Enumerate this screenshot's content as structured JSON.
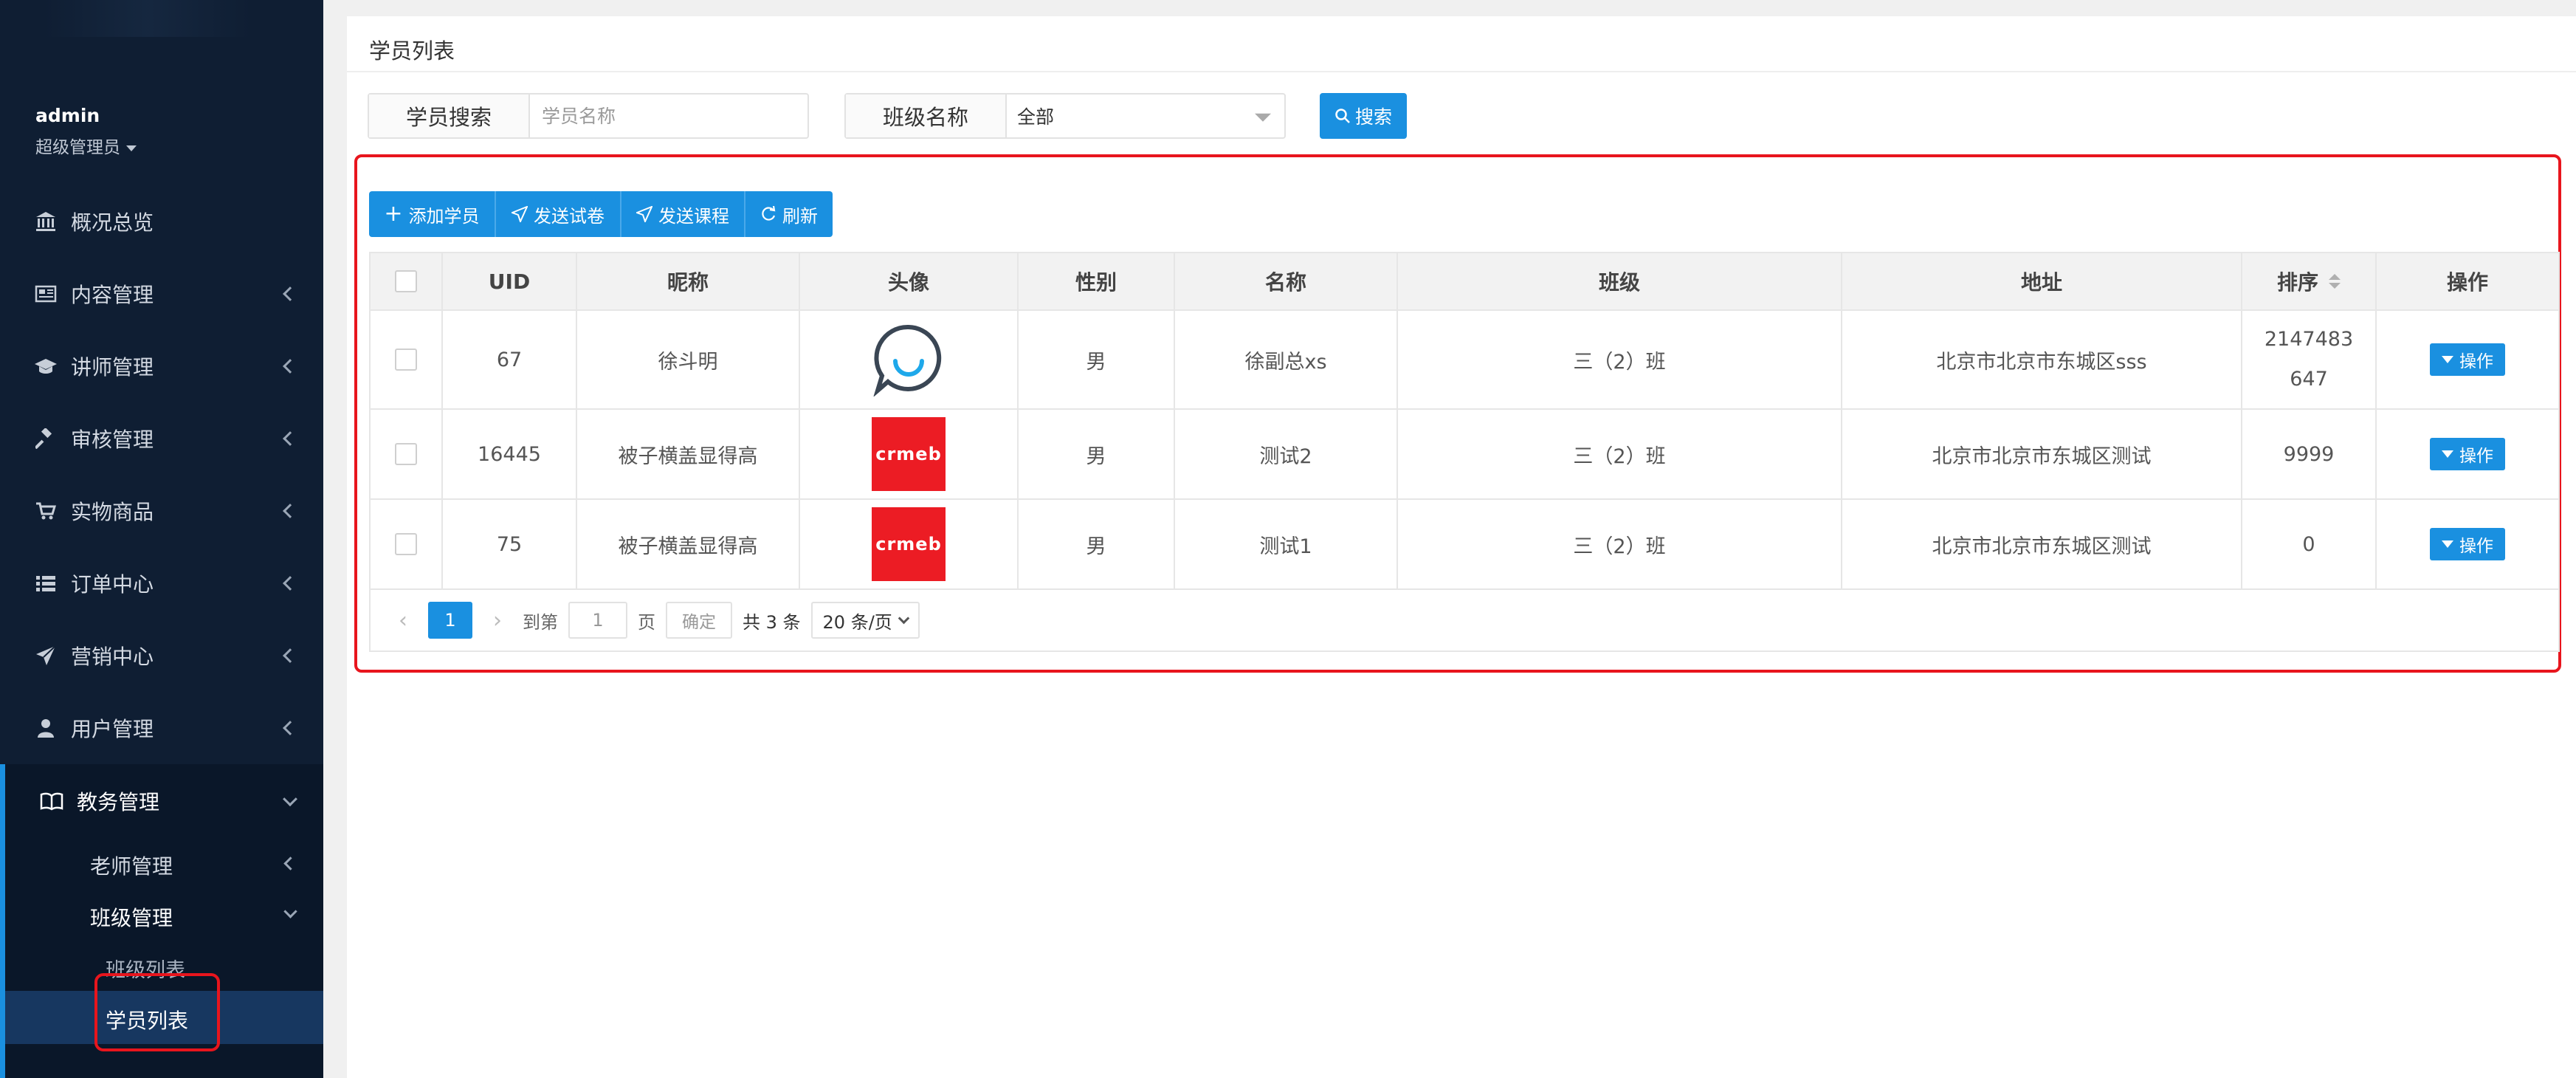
{
  "sidebar": {
    "user": {
      "name": "admin",
      "role": "超级管理员"
    },
    "items": [
      {
        "label": "概况总览",
        "icon": "bank-icon"
      },
      {
        "label": "内容管理",
        "icon": "newspaper-icon"
      },
      {
        "label": "讲师管理",
        "icon": "graduation-cap-icon"
      },
      {
        "label": "审核管理",
        "icon": "gavel-icon"
      },
      {
        "label": "实物商品",
        "icon": "cart-icon"
      },
      {
        "label": "订单中心",
        "icon": "list-icon"
      },
      {
        "label": "营销中心",
        "icon": "send-icon"
      },
      {
        "label": "用户管理",
        "icon": "user-icon"
      },
      {
        "label": "教务管理",
        "icon": "book-icon"
      }
    ],
    "sub": {
      "teacher": "老师管理",
      "class": "班级管理",
      "class_list": "班级列表",
      "student_list": "学员列表"
    }
  },
  "page": {
    "title": "学员列表",
    "search": {
      "label": "学员搜索",
      "placeholder": "学员名称",
      "class_label": "班级名称",
      "class_value": "全部",
      "button": "搜索"
    },
    "toolbar": {
      "add": "添加学员",
      "send_paper": "发送试卷",
      "send_course": "发送课程",
      "refresh": "刷新"
    },
    "table": {
      "headers": {
        "uid": "UID",
        "nickname": "昵称",
        "avatar": "头像",
        "gender": "性别",
        "name": "名称",
        "class": "班级",
        "address": "地址",
        "sort": "排序",
        "action": "操作"
      },
      "rows": [
        {
          "uid": "67",
          "nickname": "徐斗明",
          "avatar": "chat-bubble",
          "gender": "男",
          "name": "徐副总xs",
          "class": "三（2）班",
          "address": "北京市北京市东城区sss",
          "sort_line1": "2147483",
          "sort_line2": "647",
          "action": "操作"
        },
        {
          "uid": "16445",
          "nickname": "被子横盖显得高",
          "avatar": "crmeb-logo",
          "avatar_text": "crmeb",
          "gender": "男",
          "name": "测试2",
          "class": "三（2）班",
          "address": "北京市北京市东城区测试",
          "sort_line1": "9999",
          "sort_line2": "",
          "action": "操作"
        },
        {
          "uid": "75",
          "nickname": "被子横盖显得高",
          "avatar": "crmeb-logo",
          "avatar_text": "crmeb",
          "gender": "男",
          "name": "测试1",
          "class": "三（2）班",
          "address": "北京市北京市东城区测试",
          "sort_line1": "0",
          "sort_line2": "",
          "action": "操作"
        }
      ]
    },
    "pagination": {
      "current": "1",
      "goto_prefix": "到第",
      "goto_value": "1",
      "goto_suffix": "页",
      "confirm": "确定",
      "total": "共 3 条",
      "page_size": "20 条/页"
    }
  },
  "colors": {
    "accent": "#1a90e0",
    "sidebar_bg": "#0f1e33",
    "highlight": "#e8151d",
    "brand_red": "#ec1c24"
  }
}
